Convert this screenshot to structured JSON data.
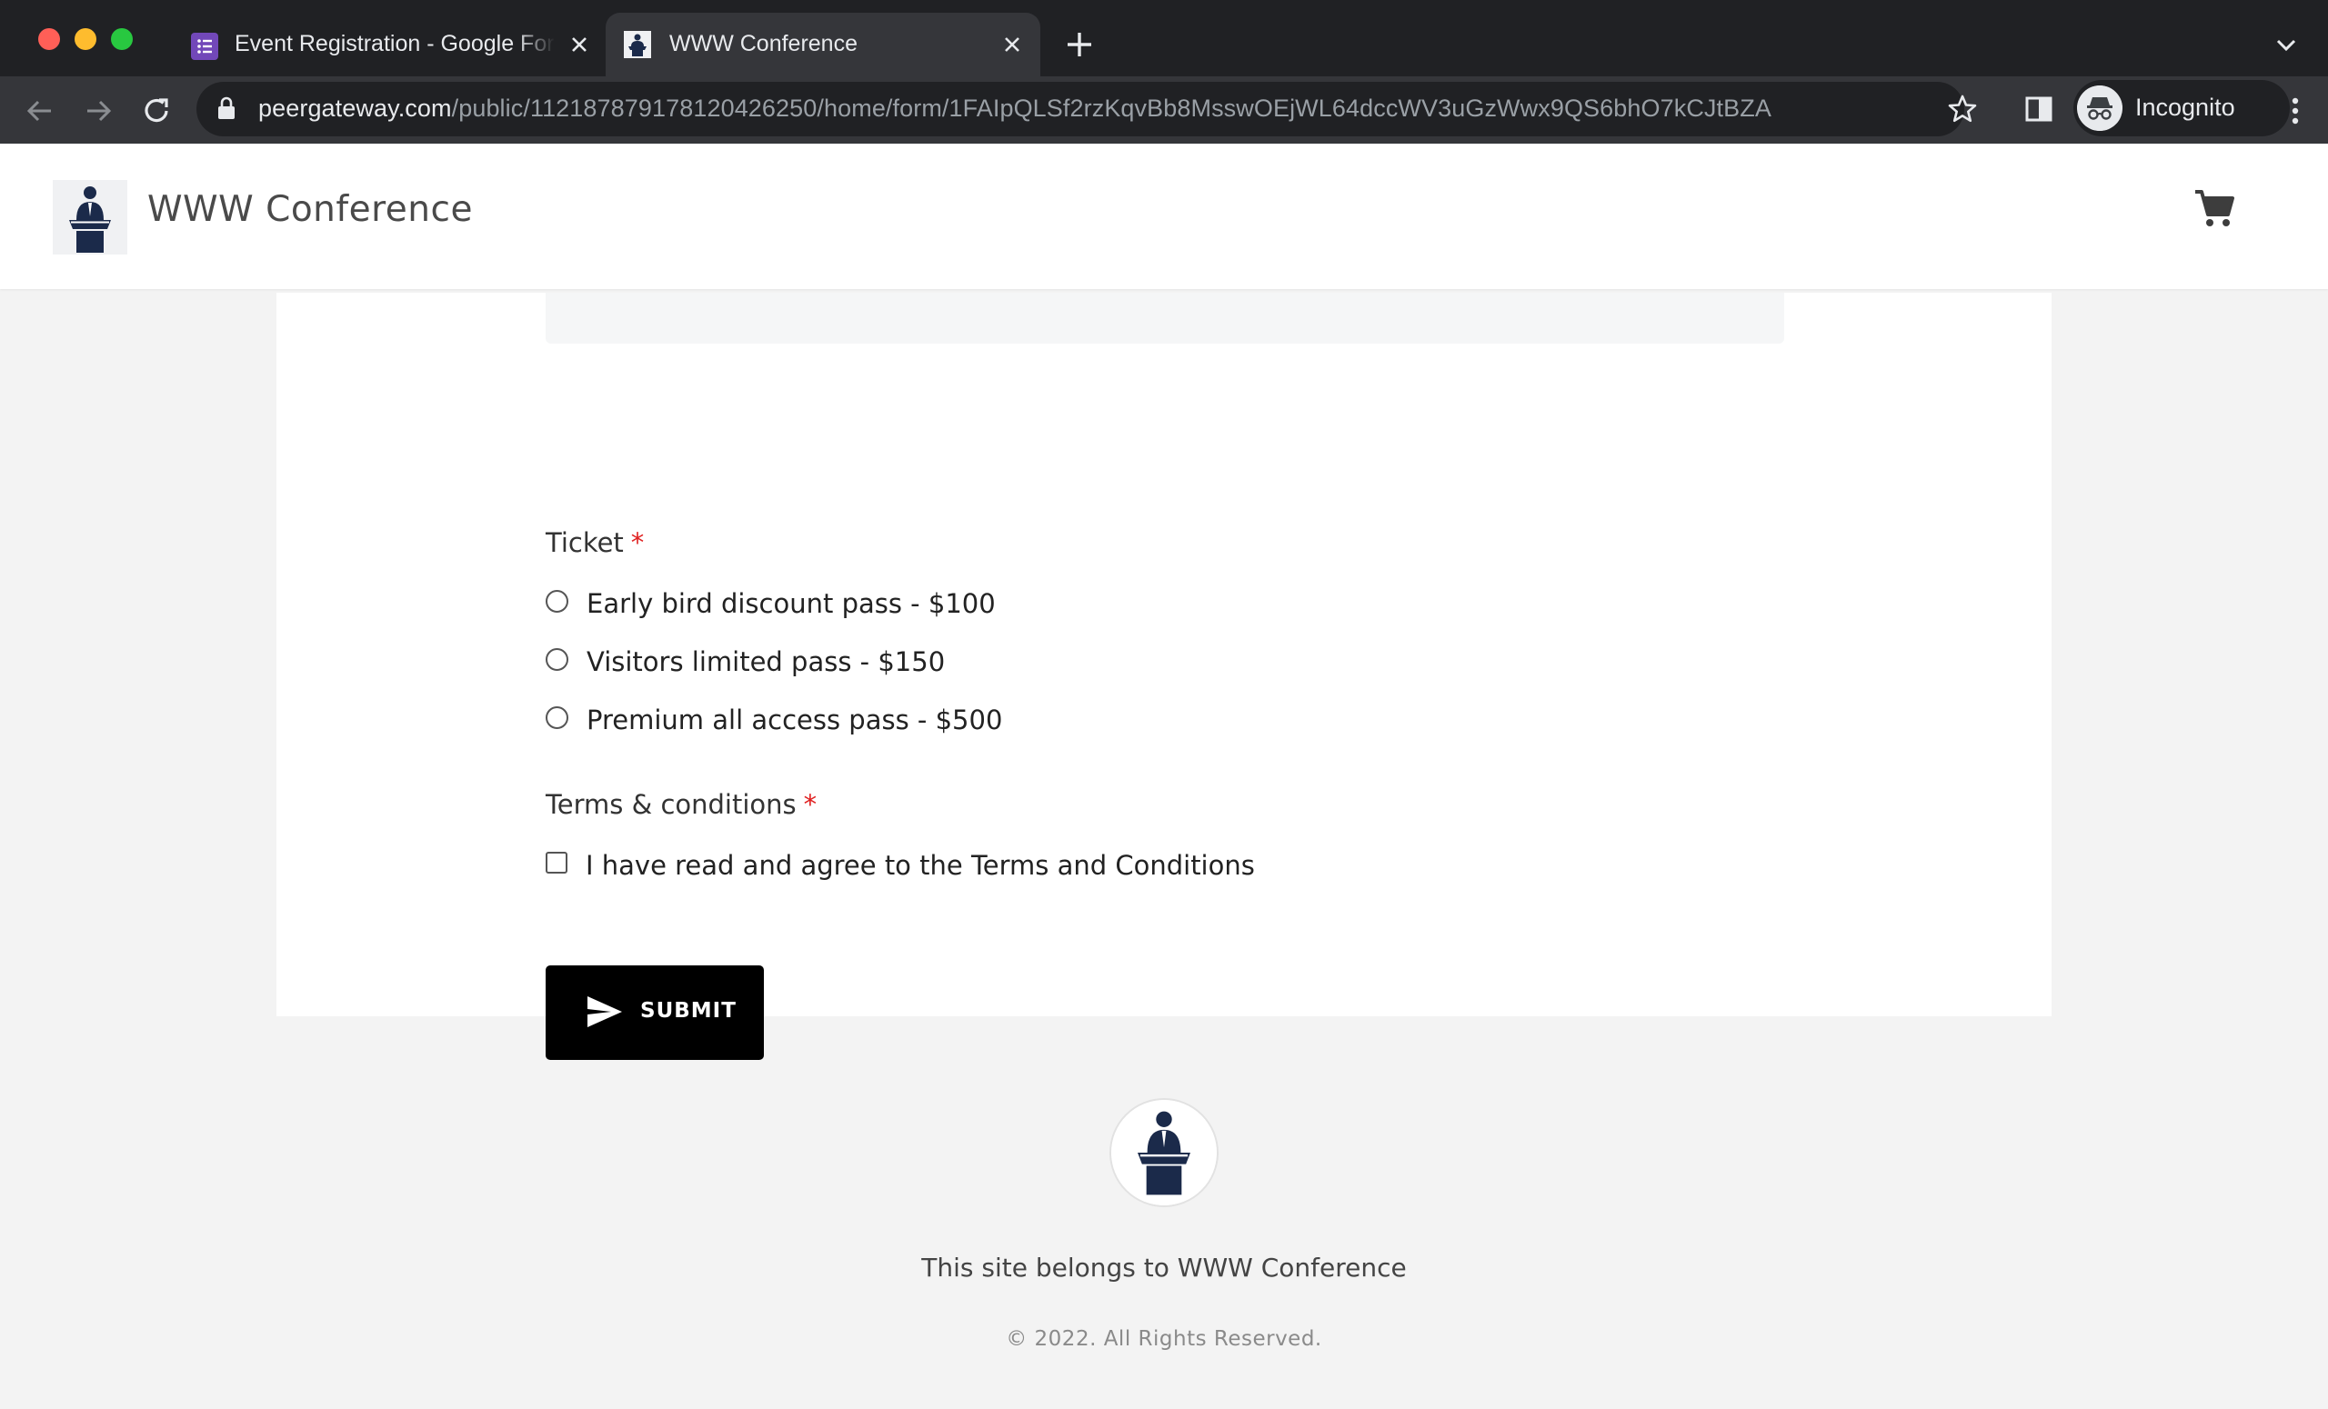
{
  "browser": {
    "tabs": [
      {
        "title": "Event Registration - Google Forms",
        "icon": "google-forms-icon",
        "active": false
      },
      {
        "title": "WWW Conference",
        "icon": "speaker-podium-icon",
        "active": true
      }
    ],
    "url_host": "peergateway.com",
    "url_path": "/public/112187879178120426250/home/form/1FAIpQLSf2rzKqvBb8MsswOEjWL64dccWV3uGzWwx9QS6bhO7kCJtBZA",
    "profile_label": "Incognito"
  },
  "header": {
    "site_name": "WWW Conference",
    "cart_icon": "cart-icon"
  },
  "form": {
    "ticket": {
      "label": "Ticket",
      "required_mark": "*",
      "options": [
        "Early bird discount pass - $100",
        "Visitors limited pass - $150",
        "Premium all access pass - $500"
      ]
    },
    "terms": {
      "label": "Terms & conditions",
      "required_mark": "*",
      "checkbox_label": "I have read and agree to the Terms and Conditions"
    },
    "submit_label": "SUBMIT"
  },
  "footer": {
    "owner_text": "This site belongs to WWW Conference",
    "copyright": "© 2022. All Rights Reserved."
  },
  "colors": {
    "chrome_bg": "#202124",
    "toolbar_bg": "#35363a",
    "page_bg": "#f3f3f3",
    "required": "#e02020",
    "button_bg": "#000000",
    "logo_navy": "#1b2a4a"
  }
}
